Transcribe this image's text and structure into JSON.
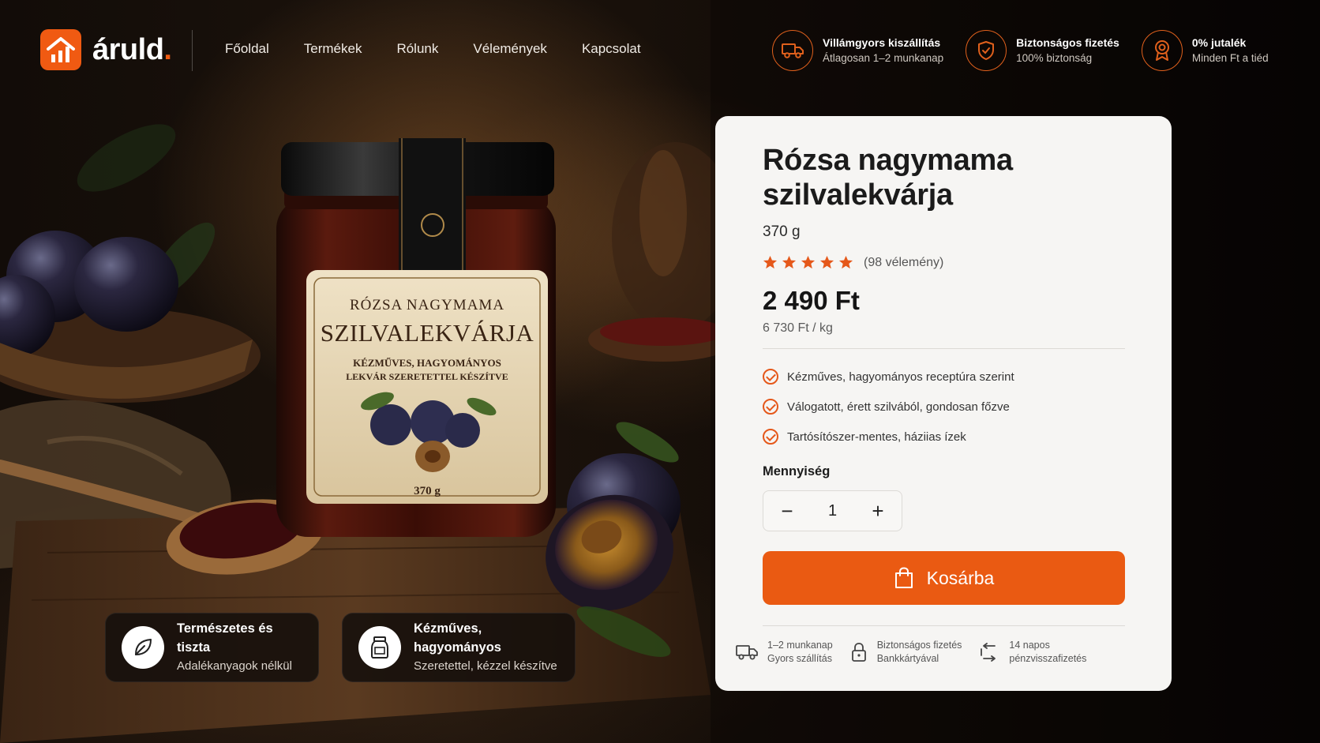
{
  "brand": {
    "name": "áruld",
    "dot": ".",
    "accent": "#f05a12"
  },
  "nav": [
    {
      "label": "Főoldal"
    },
    {
      "label": "Termékek"
    },
    {
      "label": "Rólunk"
    },
    {
      "label": "Vélemények"
    },
    {
      "label": "Kapcsolat"
    }
  ],
  "badges": [
    {
      "icon": "truck-icon",
      "title": "Villámgyors kiszállítás",
      "sub": "Átlagosan 1–2 munkanap"
    },
    {
      "icon": "shield-check-icon",
      "title": "Biztonságos fizetés",
      "sub": "100% biztonság"
    },
    {
      "icon": "award-icon",
      "title": "0% jutalék",
      "sub": "Minden Ft a tiéd"
    }
  ],
  "jar_label": {
    "line1": "RÓZSA NAGYMAMA",
    "line2": "SZILVALEKVÁRJA",
    "line3": "KÉZMŰVES, HAGYOMÁNYOS",
    "line4": "LEKVÁR SZERETETTEL KÉSZÍTVE",
    "weight": "370 g"
  },
  "pills": [
    {
      "icon": "leaf-icon",
      "title": "Természetes és tiszta",
      "sub": "Adalékanyagok nélkül"
    },
    {
      "icon": "jar-icon",
      "title": "Kézműves, hagyományos",
      "sub": "Szeretettel, kézzel készítve"
    }
  ],
  "product": {
    "title": "Rózsa nagymama szilvalekvárja",
    "weight": "370 g",
    "rating": 5,
    "reviews": "(98 vélemény)",
    "price": "2 490 Ft",
    "unit_price": "6 730 Ft / kg",
    "features": [
      "Kézműves, hagyományos receptúra szerint",
      "Válogatott, érett szilvából, gondosan főzve",
      "Tartósítószer-mentes, háziias ízek"
    ],
    "quantity_label": "Mennyiség",
    "quantity": "1",
    "cart_label": "Kosárba",
    "info": [
      {
        "icon": "truck-icon",
        "line1": "1–2 munkanap",
        "line2": "Gyors szállítás"
      },
      {
        "icon": "lock-icon",
        "line1": "Biztonságos fizetés",
        "line2": "Bankkártyával"
      },
      {
        "icon": "return-icon",
        "line1": "14 napos",
        "line2": "pénzvisszafizetés"
      }
    ]
  }
}
